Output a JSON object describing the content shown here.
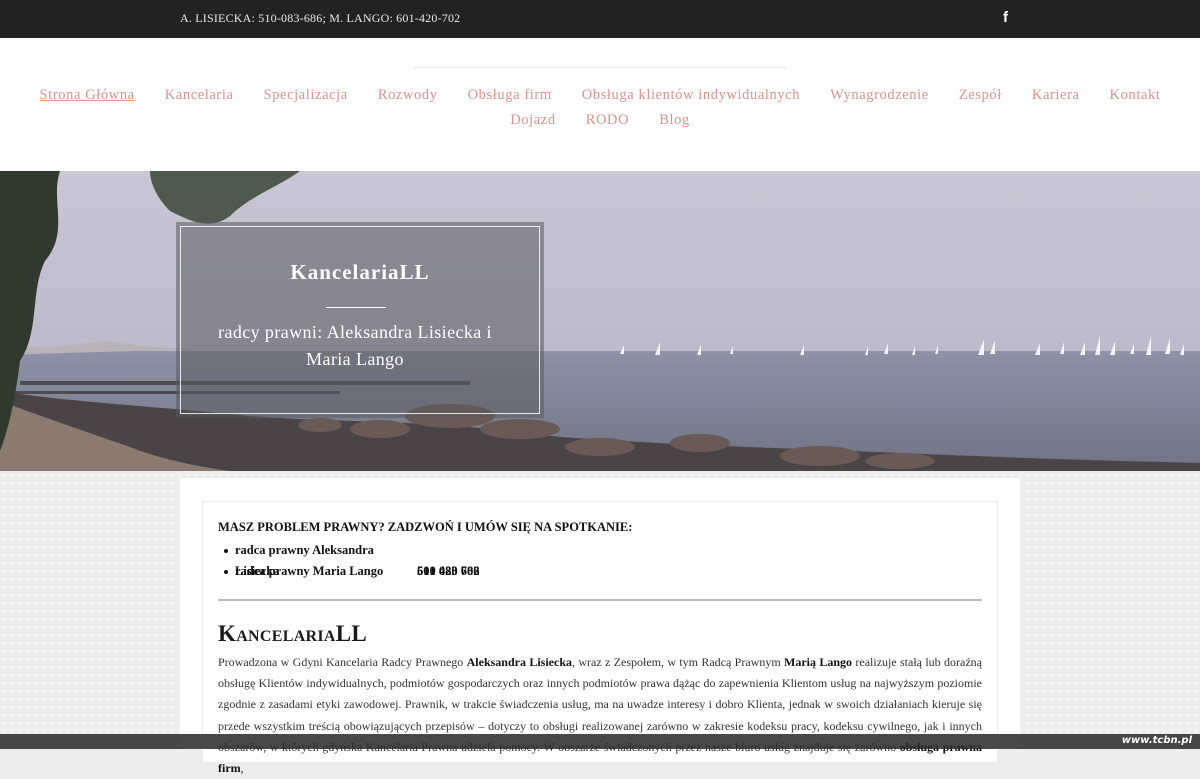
{
  "topbar": {
    "phones": "A. LISIECKA: 510-083-686; M. LANGO: 601-420-702",
    "social_icon": "facebook-icon",
    "social_glyph": "f"
  },
  "nav": {
    "row1": [
      "Strona Główna",
      "Kancelaria",
      "Specjalizacja",
      "Rozwody",
      "Obsługa firm",
      "Obsługa klientów indywidualnych",
      "Wynagrodzenie",
      "Zespół",
      "Kariera",
      "Kontakt"
    ],
    "row2": [
      "Dojazd",
      "RODO",
      "Blog"
    ],
    "active": "Strona Główna",
    "color": "#d9938c"
  },
  "hero": {
    "title": "KancelariaLL",
    "subtitle": "radcy prawni: Aleksandra Lisiecka i Maria Lango"
  },
  "content": {
    "callout": "MASZ PROBLEM PRAWNY? ZADZWOŃ I UMÓW SIĘ NA SPOTKANIE:",
    "contacts": [
      {
        "name": "radca prawny Aleksandra Lisiecka",
        "phone": "510 083 686"
      },
      {
        "name": "radca prawny Maria Lango",
        "phone": "601 420 702"
      }
    ],
    "heading": "KancelariaLL",
    "paragraph": {
      "p1": "Prowadzona w Gdyni Kancelaria Radcy Prawnego ",
      "b1": "Aleksandra Lisiecka",
      "p2": ", wraz z Zespołem, w tym Radcą Prawnym ",
      "b2": "Marią Lango",
      "p3": " realizuje stałą lub doraźną obsługę Klientów indywidualnych, podmiotów gospodarczych oraz innych podmiotów prawa dążąc do zapewnienia Klientom usług na najwyższym poziomie zgodnie z zasadami etyki zawodowej. Prawnik, w trakcie świadczenia usług, ma na uwadze interesy i dobro Klienta, jednak w swoich działaniach kieruje się przede wszystkim treścią obowiązujących przepisów – dotyczy to obsługi realizowanej zarówno w zakresie kodeksu pracy, kodeksu cywilnego, jak i innych obszarów, w których gdyńska Kancelaria Prawna udziela pomocy. W obszarze świadczonych przez nasze biuro usług znajduje się zarówno ",
      "b3": "obsługa prawna firm",
      "p4": ","
    }
  },
  "watermark": "www.tcbn.pl"
}
